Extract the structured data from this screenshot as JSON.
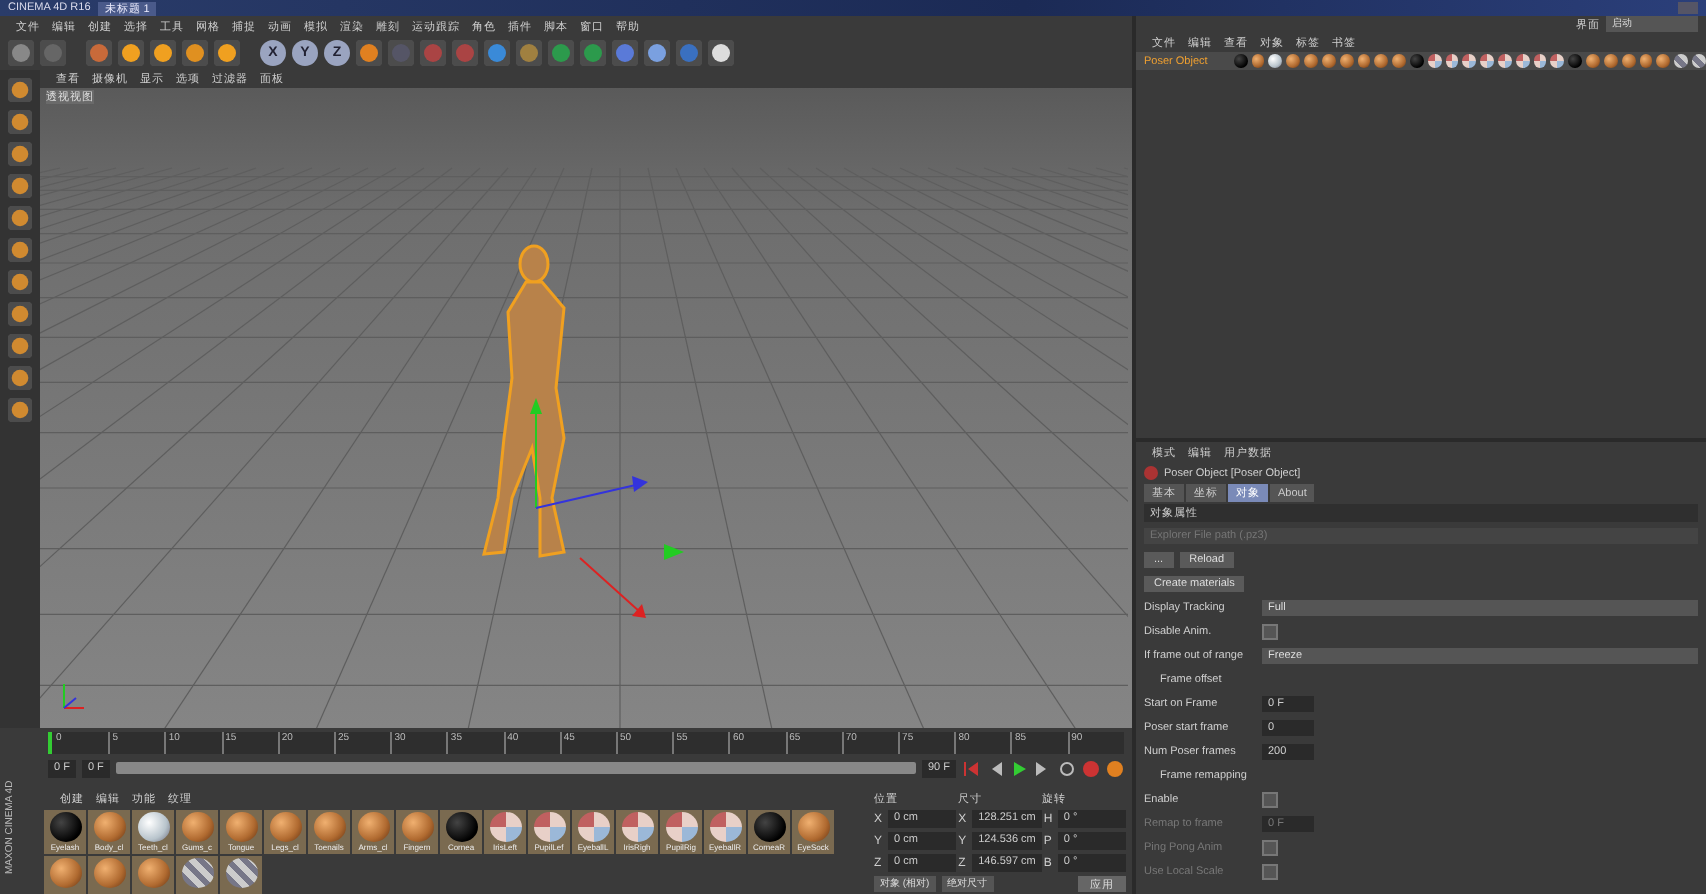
{
  "window": {
    "title": "CINEMA 4D R16",
    "document": "未标题 1"
  },
  "menu": [
    "文件",
    "编辑",
    "创建",
    "选择",
    "工具",
    "网格",
    "捕捉",
    "动画",
    "模拟",
    "渲染",
    "雕刻",
    "运动跟踪",
    "角色",
    "插件",
    "脚本",
    "窗口",
    "帮助"
  ],
  "axis_buttons": [
    "X",
    "Y",
    "Z"
  ],
  "layout": {
    "label": "界面",
    "value": "启动"
  },
  "viewport": {
    "menu": [
      "查看",
      "摄像机",
      "显示",
      "选项",
      "过滤器",
      "面板"
    ],
    "label": "透视视图"
  },
  "object_manager": {
    "menu": [
      "文件",
      "编辑",
      "查看",
      "对象",
      "标签",
      "书签"
    ],
    "objects": [
      {
        "name": "Poser Object",
        "selected": true,
        "tags": [
          {
            "kind": "black"
          },
          {
            "kind": "skin"
          },
          {
            "kind": "white"
          },
          {
            "kind": "skin"
          },
          {
            "kind": "skin"
          },
          {
            "kind": "skin"
          },
          {
            "kind": "skin"
          },
          {
            "kind": "skin"
          },
          {
            "kind": "skin"
          },
          {
            "kind": "skin"
          },
          {
            "kind": "black"
          },
          {
            "kind": "eye"
          },
          {
            "kind": "eye"
          },
          {
            "kind": "eye"
          },
          {
            "kind": "eye"
          },
          {
            "kind": "eye"
          },
          {
            "kind": "eye"
          },
          {
            "kind": "eye"
          },
          {
            "kind": "eye"
          },
          {
            "kind": "black"
          },
          {
            "kind": "skin"
          },
          {
            "kind": "skin"
          },
          {
            "kind": "skin"
          },
          {
            "kind": "skin"
          },
          {
            "kind": "skin"
          },
          {
            "kind": "striped"
          },
          {
            "kind": "striped"
          }
        ]
      }
    ]
  },
  "attributes": {
    "menu": [
      "模式",
      "编辑",
      "用户数据"
    ],
    "object_title": "Poser Object [Poser Object]",
    "tabs": [
      {
        "label": "基本",
        "selected": false
      },
      {
        "label": "坐标",
        "selected": false
      },
      {
        "label": "对象",
        "selected": true
      },
      {
        "label": "About",
        "selected": false
      }
    ],
    "section": "对象属性",
    "rows": [
      {
        "kind": "path",
        "placeholder": "Explorer File path (.pz3)",
        "disabled": false
      },
      {
        "kind": "buttons",
        "labels": [
          "...",
          "Reload"
        ],
        "disabled": false
      },
      {
        "kind": "button",
        "label": "Create materials",
        "disabled": false
      },
      {
        "kind": "dropdown",
        "label": "Display Tracking",
        "value": "Full",
        "disabled": false
      },
      {
        "kind": "checkbox",
        "label": "Disable Anim.",
        "checked": false,
        "disabled": false
      },
      {
        "kind": "dropdown",
        "label": "If frame out of range",
        "value": "Freeze",
        "disabled": false
      },
      {
        "kind": "heading",
        "label": "Frame offset",
        "disabled": false
      },
      {
        "kind": "number",
        "label": "Start on Frame",
        "value": "0 F",
        "disabled": false
      },
      {
        "kind": "number",
        "label": "Poser start frame",
        "value": "0",
        "disabled": false
      },
      {
        "kind": "number",
        "label": "Num Poser frames",
        "value": "200",
        "disabled": false
      },
      {
        "kind": "heading",
        "label": "Frame remapping",
        "disabled": false
      },
      {
        "kind": "checkbox",
        "label": "Enable",
        "checked": false,
        "disabled": false
      },
      {
        "kind": "number",
        "label": "Remap to frame",
        "value": "0 F",
        "disabled": true
      },
      {
        "kind": "checkbox",
        "label": "Ping Pong Anim",
        "checked": false,
        "disabled": true
      },
      {
        "kind": "checkbox",
        "label": "Use Local Scale",
        "checked": false,
        "disabled": true
      }
    ]
  },
  "timeline": {
    "ticks": [
      "0",
      "5",
      "10",
      "15",
      "20",
      "25",
      "30",
      "35",
      "40",
      "45",
      "50",
      "55",
      "60",
      "65",
      "70",
      "75",
      "80",
      "85",
      "90"
    ],
    "level": 0,
    "range": {
      "level": 1
    },
    "start": "0 F",
    "current": "0 F",
    "end": "90 F"
  },
  "materials": {
    "menu": [
      "创建",
      "编辑",
      "功能",
      "纹理"
    ],
    "items": [
      {
        "name": "Eyelash",
        "kind": "black"
      },
      {
        "name": "Body_cl",
        "kind": "skin"
      },
      {
        "name": "Teeth_cl",
        "kind": "white"
      },
      {
        "name": "Gums_c",
        "kind": "skin"
      },
      {
        "name": "Tongue",
        "kind": "skin"
      },
      {
        "name": "Legs_cl",
        "kind": "skin"
      },
      {
        "name": "Toenails",
        "kind": "skin"
      },
      {
        "name": "Arms_cl",
        "kind": "skin"
      },
      {
        "name": "Fingern",
        "kind": "skin"
      },
      {
        "name": "Cornea",
        "kind": "black"
      },
      {
        "name": "IrisLeft",
        "kind": "eye"
      },
      {
        "name": "PupilLef",
        "kind": "eye"
      },
      {
        "name": "EyeballL",
        "kind": "eye"
      },
      {
        "name": "IrisRigh",
        "kind": "eye"
      },
      {
        "name": "PupilRig",
        "kind": "eye"
      },
      {
        "name": "EyeballR",
        "kind": "eye"
      },
      {
        "name": "CorneaR",
        "kind": "black"
      },
      {
        "name": "EyeSock",
        "kind": "skin"
      }
    ],
    "more": [
      {
        "kind": "skin"
      },
      {
        "kind": "skin"
      },
      {
        "kind": "skin"
      },
      {
        "kind": "striped"
      },
      {
        "kind": "striped"
      }
    ]
  },
  "coordinates": {
    "headers": [
      "位置",
      "尺寸",
      "旋转"
    ],
    "rows": [
      {
        "axis": "X",
        "position": "0 cm",
        "size_axis": "X",
        "size": "128.251 cm",
        "rot_axis": "H",
        "rotation": "0 °"
      },
      {
        "axis": "Y",
        "position": "0 cm",
        "size_axis": "Y",
        "size": "124.536 cm",
        "rot_axis": "P",
        "rotation": "0 °"
      },
      {
        "axis": "Z",
        "position": "0 cm",
        "size_axis": "Z",
        "size": "146.597 cm",
        "rot_axis": "B",
        "rotation": "0 °"
      }
    ],
    "modes": [
      "对象 (相对)",
      "绝对尺寸"
    ],
    "apply": "应用"
  },
  "brand": "MAXON CINEMA 4D"
}
